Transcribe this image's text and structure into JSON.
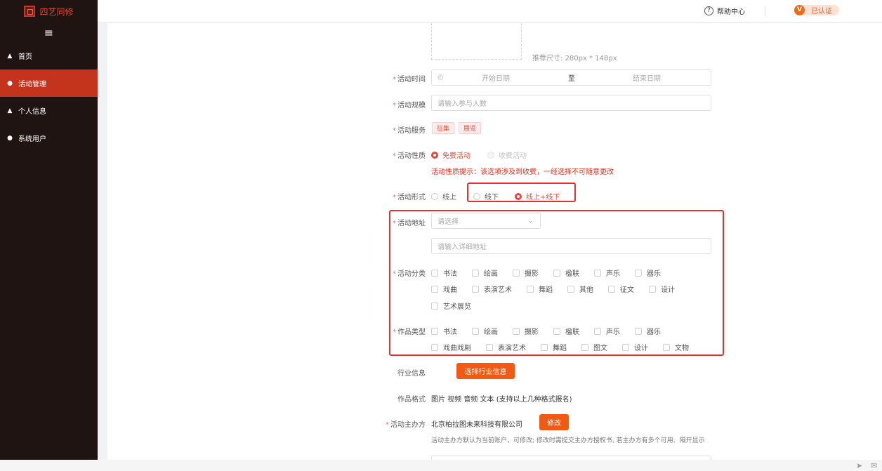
{
  "app": {
    "title": "四艺同修"
  },
  "sidebar": {
    "items": [
      {
        "label": "首页",
        "icon": "home-icon"
      },
      {
        "label": "活动管理",
        "icon": "activity-icon"
      },
      {
        "label": "个人信息",
        "icon": "user-icon"
      },
      {
        "label": "系统用户",
        "icon": "users-icon"
      }
    ]
  },
  "header": {
    "help_label": "帮助中心",
    "help_icon": "?",
    "verified_label": "已认证",
    "verified_icon": "V"
  },
  "form": {
    "cover_hint": "推荐尺寸: 280px * 148px",
    "time": {
      "label": "活动时间",
      "start_placeholder": "开始日期",
      "sep": "至",
      "end_placeholder": "结束日期"
    },
    "scale": {
      "label": "活动规模",
      "placeholder": "请输入参与人数"
    },
    "service": {
      "label": "活动服务",
      "tags": [
        "征集",
        "展览"
      ]
    },
    "nature": {
      "label": "活动性质",
      "options": [
        "免费活动",
        "收费活动"
      ],
      "warning": "活动性质提示：该选项涉及到收费，一经选择不可随意更改"
    },
    "form_type": {
      "label": "活动形式",
      "options": [
        "线上",
        "线下",
        "线上+线下"
      ]
    },
    "address": {
      "label": "活动地址",
      "select_placeholder": "请选择",
      "detail_placeholder": "请输入详细地址"
    },
    "category": {
      "label": "活动分类",
      "options": [
        "书法",
        "绘画",
        "摄影",
        "楹联",
        "声乐",
        "器乐",
        "戏曲",
        "表演艺术",
        "舞蹈",
        "其他",
        "征文",
        "设计",
        "艺术展览"
      ]
    },
    "work_type": {
      "label": "作品类型",
      "options": [
        "书法",
        "绘画",
        "摄影",
        "楹联",
        "声乐",
        "器乐",
        "戏曲戏剧",
        "表演艺术",
        "舞蹈",
        "图文",
        "设计",
        "文物"
      ]
    },
    "industry": {
      "label": "行业信息",
      "button": "选择行业信息"
    },
    "work_format": {
      "label": "作品格式",
      "value": "图片 视频 音频 文本 (支持以上几种格式报名)"
    },
    "organizer": {
      "label": "活动主办方",
      "value": "北京柏拉图未来科技有限公司",
      "button": "修改",
      "hint": "活动主办方默认为当前账户，可修改; 修改时需提交主办方授权书, 若主办方有多个可用、隔开显示"
    }
  },
  "colors": {
    "sidebar_bg": "#1f1412",
    "active": "#c4341c",
    "accent": "#f05a14",
    "warning": "#d9301c"
  }
}
